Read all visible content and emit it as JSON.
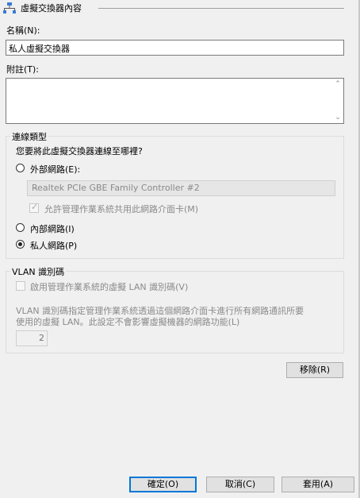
{
  "section": {
    "title": "虛擬交換器內容",
    "icon": "network-switch-icon"
  },
  "name": {
    "label": "名稱(N):",
    "value": "私人虛擬交換器"
  },
  "notes": {
    "label": "附註(T):",
    "value": ""
  },
  "connection_type": {
    "title": "連線類型",
    "question": "您要將此虛擬交換器連線至哪裡?",
    "external": {
      "label": "外部網路(E):",
      "checked": false
    },
    "adapter": {
      "selected": "Realtek PCIe GBE Family Controller #2"
    },
    "allow_os_share": {
      "label": "允許管理作業系統共用此網路介面卡(M)",
      "checked": true
    },
    "internal": {
      "label": "內部網路(I)",
      "checked": false
    },
    "private": {
      "label": "私人網路(P)",
      "checked": true
    }
  },
  "vlan": {
    "title": "VLAN 識別碼",
    "enable": {
      "label": "啟用管理作業系統的虛擬 LAN 識別碼(V)",
      "checked": false
    },
    "description_line1": "VLAN 識別碼指定管理作業系統透過這個網路介面卡進行所有網路通訊所要",
    "description_line2": "使用的虛擬 LAN。此設定不會影響虛擬機器的網路功能(L)",
    "id_value": "2"
  },
  "remove_button": "移除(R)",
  "footer": {
    "ok": "確定(O)",
    "cancel": "取消(C)",
    "apply": "套用(A)"
  }
}
